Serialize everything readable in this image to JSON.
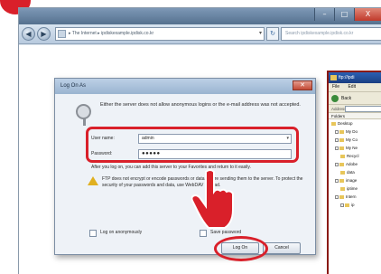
{
  "colors": {
    "highlight": "#d9202a",
    "dialog_bg": "#eef2f7",
    "titlebar": "#55718f"
  },
  "browser": {
    "address": "▸ The Internet ▸ ipdiskexample.ipdisk.co.kr",
    "search_placeholder": "Search ipdiskexample.ipdisk.co.kr",
    "win_minimize": "–",
    "win_maximize": "□",
    "win_close": "X",
    "back_glyph": "◀",
    "forward_glyph": "▶",
    "refresh_glyph": "↻",
    "addr_dropdown": "▾"
  },
  "dialog": {
    "title": "Log On As",
    "close_glyph": "✕",
    "message": "Either the server does not allow anonymous logins or the e-mail address was not accepted.",
    "username_label": "User name:",
    "username_value": "admin",
    "username_dropdown": "▾",
    "password_label": "Password:",
    "password_value": "●●●●●",
    "after_logon_text": "After you log on, you can add this server to your Favorites and return to it easily.",
    "warning_text": "FTP does not encrypt or encode passwords or data before sending them to the server. To protect the security of your passwords and data, use WebDAV instead.",
    "anonymous_label": "Log on anonymously",
    "save_password_label": "Save password",
    "logon_button": "Log On",
    "cancel_button": "Cancel"
  },
  "ftp_window": {
    "title": "ftp://ipdi",
    "menu": [
      "File",
      "Edit"
    ],
    "back_label": "Back",
    "address_label": "Address",
    "folders_label": "Folders",
    "tree": [
      "Desktop",
      "My Do",
      "My Co",
      "My Ne",
      "Recycl",
      "Adobe",
      "data",
      "image",
      "iptime",
      "Intern",
      "ip"
    ]
  }
}
